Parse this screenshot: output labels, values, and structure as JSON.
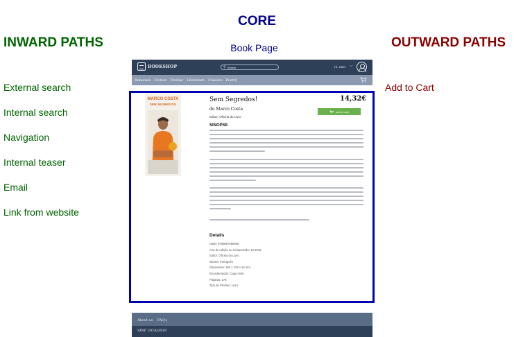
{
  "diagram": {
    "core_title": "CORE",
    "core_subtitle": "Book Page",
    "inward_title": "INWARD PATHS",
    "outward_title": "OUTWARD PATHS",
    "inward_paths": [
      "External search",
      "Internal search",
      "Navigation",
      "Internal teaser",
      "Email",
      "Link from website"
    ],
    "outward_paths": [
      "Add to Cart"
    ],
    "colors": {
      "core": "#00008b",
      "inward": "#006400",
      "outward": "#8b0000"
    }
  },
  "mock_page": {
    "logo_text": "BOOKSHOP",
    "search_placeholder": "Search",
    "user_label": "Hi, User",
    "nav_items": [
      "Romance",
      "Fiction",
      "Thriller",
      "Literature",
      "Classics",
      "Poetry"
    ],
    "book": {
      "title": "Sem Segredos!",
      "author": "de Marco Costa",
      "publisher": "Editor: Oficina do Livro",
      "price": "14,32€",
      "add_button_label": "add to cart",
      "cover_author": "MARCO COSTA",
      "cover_title": "SEM SEGREDOS!"
    },
    "synopsis_heading": "SINOPSE",
    "details_heading": "Details",
    "details": [
      "ISBN: 9789897280865",
      "Ano de edição ou reimpressão: 10-2016",
      "Editor: Oficina do Livro",
      "Idioma: Português",
      "Dimensões: 163 x 235 x 14 mm",
      "Encadernação: Capa mole",
      "Páginas: 176",
      "Tipo de Produto: Livro"
    ],
    "footer_links": [
      "About us",
      "FAQ's"
    ],
    "footer_copy": "SINF 2018/2019",
    "colors": {
      "header": "#2e4057",
      "nav": "#8b9ab0",
      "button": "#6ab04c",
      "core_frame": "#0000b0"
    }
  }
}
